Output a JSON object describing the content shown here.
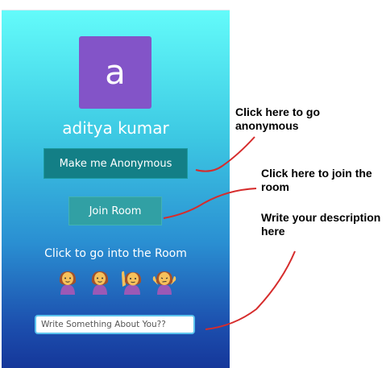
{
  "profile": {
    "avatar_letter": "a",
    "avatar_color": "#8354c8",
    "user_name": "aditya kumar"
  },
  "buttons": {
    "anonymous_label": "Make me Anonymous",
    "join_room_label": "Join Room"
  },
  "hint_text": "Click to go into the Room",
  "emojis": [
    "woman-standing-icon",
    "woman-standing-icon",
    "woman-raising-hand-icon",
    "woman-shrugging-icon"
  ],
  "description": {
    "placeholder": "Write Something About You??",
    "value": ""
  },
  "annotations": {
    "anonymous": "Click here to go anonymous",
    "join": "Click here to join the room",
    "description": "Write your description here"
  },
  "colors": {
    "background_top": "#63fbfa",
    "background_bottom": "#15379a",
    "anonymous_button": "#137f86",
    "join_button": "#31a0a4",
    "arrow": "#d62c2c"
  }
}
